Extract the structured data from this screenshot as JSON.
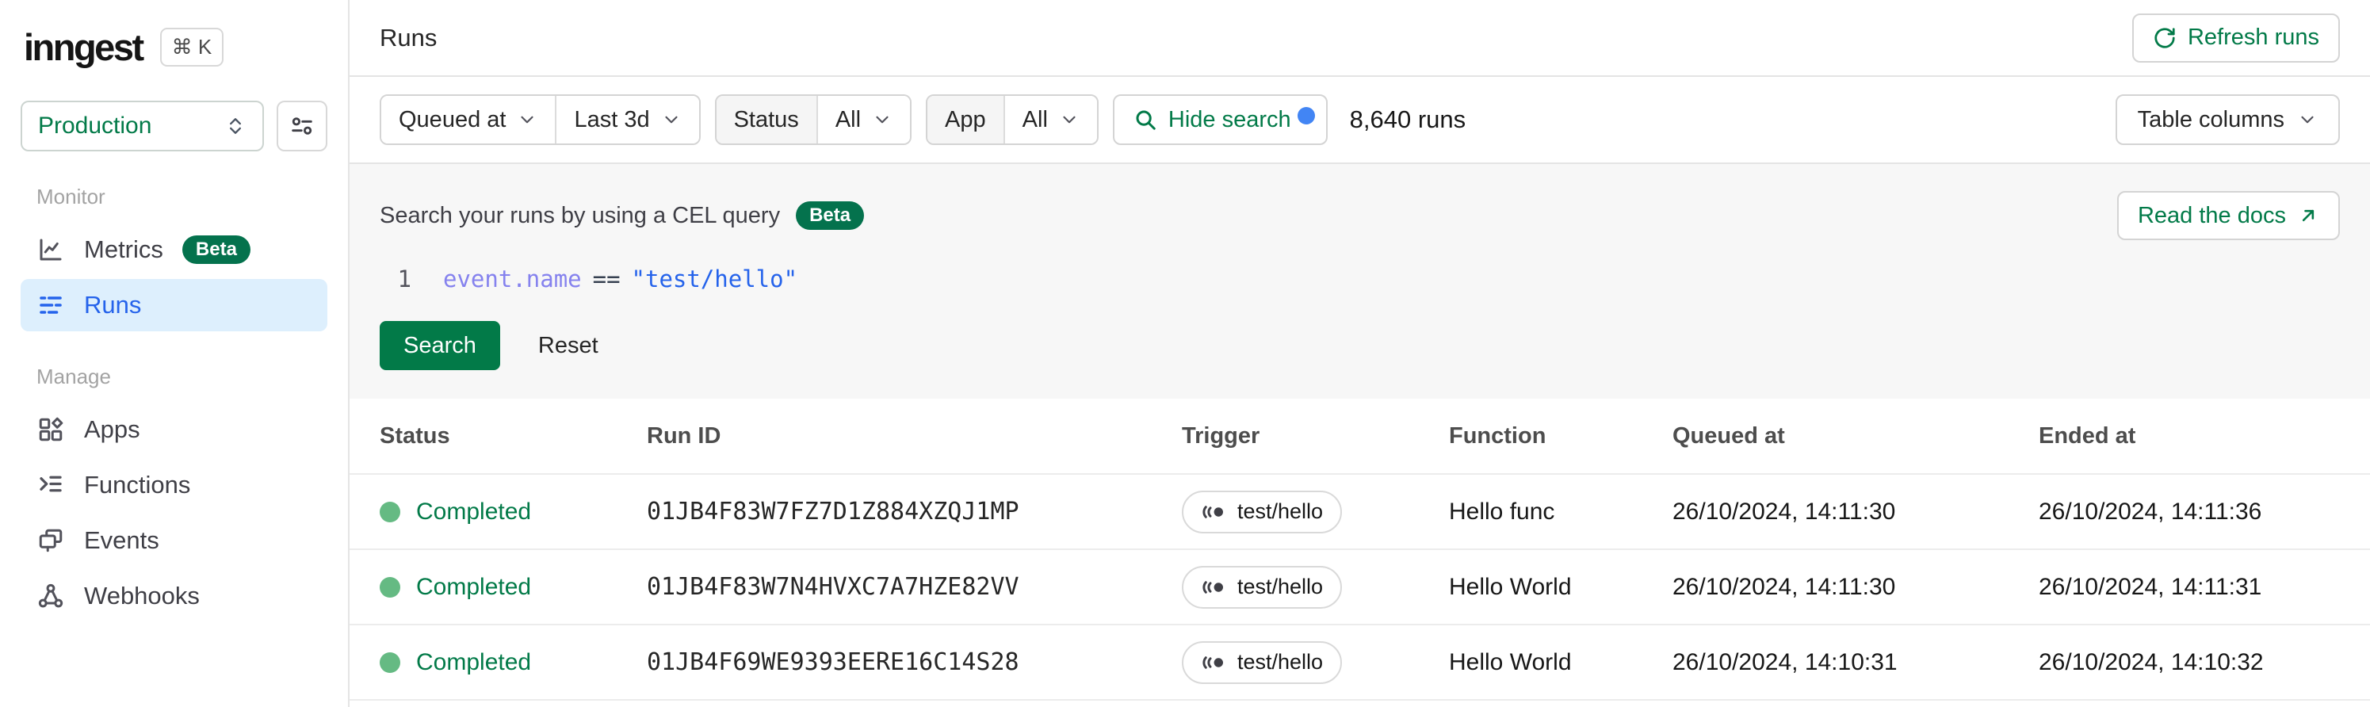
{
  "brand": {
    "logo": "inngest",
    "shortcut": "⌘ K"
  },
  "sidebar": {
    "env_selector": {
      "value": "Production"
    },
    "sections": [
      {
        "label": "Monitor",
        "items": [
          {
            "label": "Metrics",
            "badge": "Beta"
          },
          {
            "label": "Runs"
          }
        ]
      },
      {
        "label": "Manage",
        "items": [
          {
            "label": "Apps"
          },
          {
            "label": "Functions"
          },
          {
            "label": "Events"
          },
          {
            "label": "Webhooks"
          }
        ]
      }
    ]
  },
  "header": {
    "title": "Runs",
    "refresh_label": "Refresh runs"
  },
  "filters": {
    "time_field": "Queued at",
    "time_range": "Last 3d",
    "status_label": "Status",
    "status_value": "All",
    "app_label": "App",
    "app_value": "All",
    "search_toggle_label": "Hide search",
    "runs_count": "8,640 runs",
    "table_columns_label": "Table columns"
  },
  "search_panel": {
    "title": "Search your runs by using a CEL query",
    "badge": "Beta",
    "docs_label": "Read the docs",
    "line_number": "1",
    "query": {
      "object": "event",
      "dot": ".",
      "property": "name",
      "operator": "==",
      "value": "\"test/hello\""
    },
    "search_label": "Search",
    "reset_label": "Reset"
  },
  "table": {
    "columns": [
      "Status",
      "Run ID",
      "Trigger",
      "Function",
      "Queued at",
      "Ended at"
    ],
    "rows": [
      {
        "status": "Completed",
        "run_id": "01JB4F83W7FZ7D1Z884XZQJ1MP",
        "trigger": "test/hello",
        "function": "Hello func",
        "queued_at": "26/10/2024, 14:11:30",
        "ended_at": "26/10/2024, 14:11:36"
      },
      {
        "status": "Completed",
        "run_id": "01JB4F83W7N4HVXC7A7HZE82VV",
        "trigger": "test/hello",
        "function": "Hello World",
        "queued_at": "26/10/2024, 14:11:30",
        "ended_at": "26/10/2024, 14:11:31"
      },
      {
        "status": "Completed",
        "run_id": "01JB4F69WE9393EERE16C14S28",
        "trigger": "test/hello",
        "function": "Hello World",
        "queued_at": "26/10/2024, 14:10:31",
        "ended_at": "26/10/2024, 14:10:32"
      }
    ]
  },
  "colors": {
    "accent_green": "#027a48",
    "badge_green": "#04724d",
    "active_blue": "#2563eb",
    "active_blue_bg": "#ddeffd",
    "status_dot_green": "#65ba83",
    "notification_blue": "#4285f4",
    "code_property": "#8582ee",
    "code_string": "#2563eb"
  }
}
